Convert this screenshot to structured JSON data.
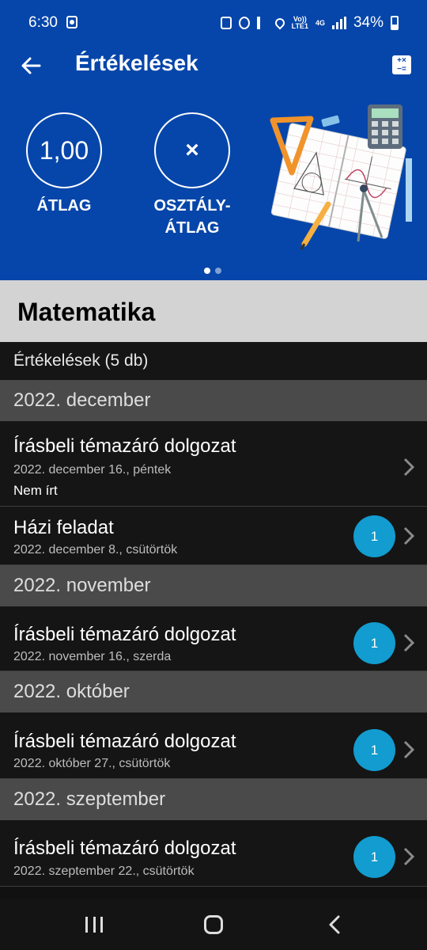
{
  "status_bar": {
    "time": "6:30",
    "volte_top": "Vo))",
    "volte_bottom": "LTE1",
    "network": "4G",
    "battery": "34%"
  },
  "header": {
    "title": "Értékelések",
    "average_value": "1,00",
    "average_label": "ÁTLAG",
    "class_average_value": "×",
    "class_average_label_1": "OSZTÁLY-",
    "class_average_label_2": "ÁTLAG",
    "calc_icon_top": "+×",
    "calc_icon_bottom": "−=",
    "carousel_pages": 2,
    "carousel_active": 1
  },
  "subject": "Matematika",
  "count_label": "Értékelések (5 db)",
  "groups": [
    {
      "month": "2022. december"
    },
    {
      "month": "2022. november"
    },
    {
      "month": "2022. október"
    },
    {
      "month": "2022. szeptember"
    }
  ],
  "entries": [
    {
      "title": "Írásbeli témazáró dolgozat",
      "date": "2022. december 16., péntek",
      "note": "Nem írt"
    },
    {
      "title": "Házi feladat",
      "date": "2022. december 8., csütörtök",
      "grade": "1"
    },
    {
      "title": "Írásbeli témazáró dolgozat",
      "date": "2022. november 16., szerda",
      "grade": "1"
    },
    {
      "title": "Írásbeli témazáró dolgozat",
      "date": "2022. október 27., csütörtök",
      "grade": "1"
    },
    {
      "title": "Írásbeli témazáró dolgozat",
      "date": "2022. szeptember 22., csütörtök",
      "grade": "1"
    }
  ],
  "colors": {
    "primary": "#0646aa",
    "badge": "#129ccf",
    "section": "#4a4a4a",
    "row_bg": "#151515",
    "subject_bg": "#d3d3d3"
  },
  "icons": [
    "back-arrow-icon",
    "calculator-icon",
    "chevron-right-icon",
    "nav-recent-icon",
    "nav-home-icon",
    "nav-back-icon"
  ]
}
